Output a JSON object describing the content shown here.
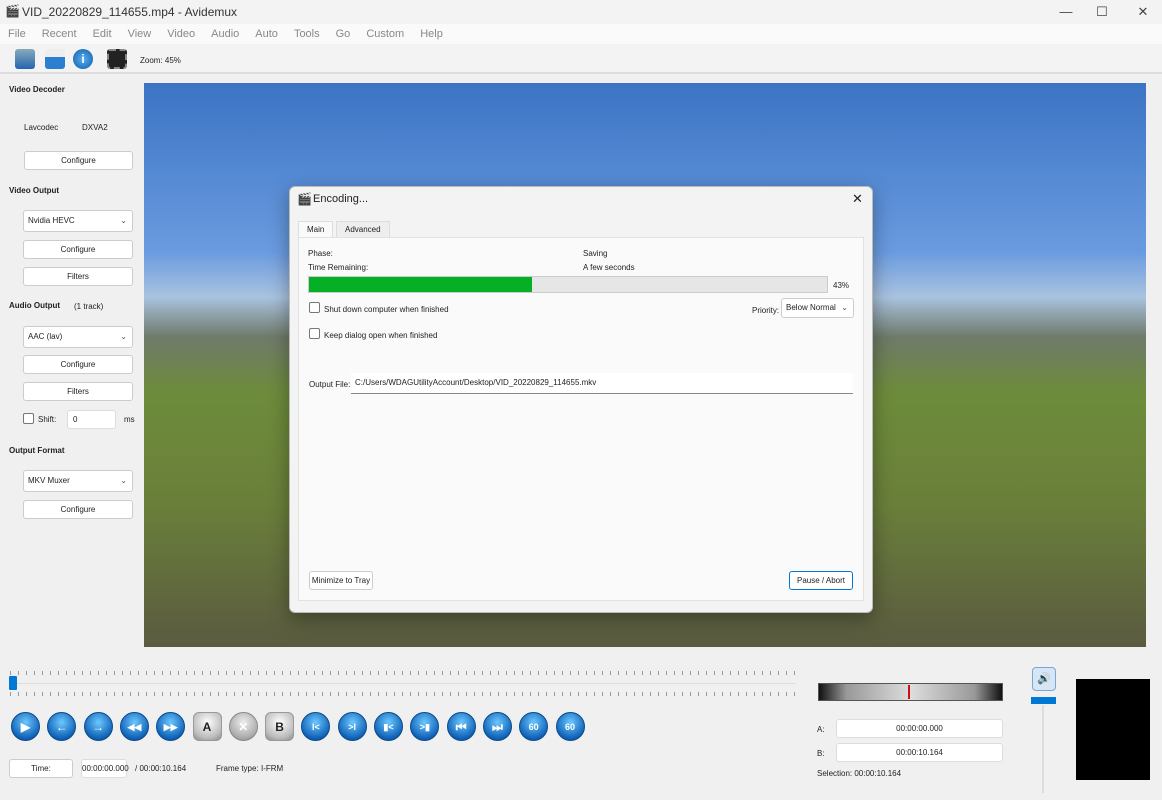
{
  "window": {
    "title": "VID_20220829_114655.mp4 - Avidemux",
    "minimize": "—",
    "maximize": "☐",
    "close": "✕"
  },
  "menu": [
    "File",
    "Recent",
    "Edit",
    "View",
    "Video",
    "Audio",
    "Auto",
    "Tools",
    "Go",
    "Custom",
    "Help"
  ],
  "toolbar": {
    "zoom": "Zoom: 45%",
    "icons": [
      "open-file-icon",
      "save-icon",
      "info-icon",
      "filters-icon"
    ]
  },
  "left": {
    "video_decoder": {
      "title": "Video Decoder",
      "decoder": "Lavcodec",
      "hw": "DXVA2",
      "configure": "Configure"
    },
    "video_output": {
      "title": "Video Output",
      "codec": "Nvidia HEVC",
      "configure": "Configure",
      "filters": "Filters"
    },
    "audio_output": {
      "title": "Audio Output",
      "tracks": "(1 track)",
      "codec": "AAC (lav)",
      "configure": "Configure",
      "filters": "Filters",
      "shift_label": "Shift:",
      "shift_value": "0",
      "shift_unit": "ms",
      "shift_checked": false
    },
    "output_format": {
      "title": "Output Format",
      "muxer": "MKV Muxer",
      "configure": "Configure"
    }
  },
  "dialog": {
    "title": "Encoding...",
    "tabs": [
      "Main",
      "Advanced"
    ],
    "active_tab": "Main",
    "phase_label": "Phase:",
    "phase_value": "Saving",
    "time_label": "Time Remaining:",
    "time_value": "A few seconds",
    "progress": 43,
    "progress_text": "43%",
    "progress_color": "#06b025",
    "shutdown_label": "Shut down computer when finished",
    "shutdown_checked": false,
    "keep_open_label": "Keep dialog open when finished",
    "keep_open_checked": false,
    "priority_label": "Priority:",
    "priority_value": "Below Normal",
    "output_label": "Output File:",
    "output_value": "C:/Users/WDAGUtilityAccount/Desktop/VID_20220829_114655.mkv",
    "minimize_button": "Minimize to Tray",
    "pause_button": "Pause / Abort"
  },
  "timeline": {
    "position": 0
  },
  "controls": [
    {
      "name": "play-button",
      "glyph": "▶"
    },
    {
      "name": "previous-frame-button",
      "glyph": "←"
    },
    {
      "name": "next-frame-button",
      "glyph": "→"
    },
    {
      "name": "rewind-button",
      "glyph": "◀◀"
    },
    {
      "name": "fast-forward-button",
      "glyph": "▶▶"
    },
    {
      "name": "set-marker-a-button",
      "glyph": "A"
    },
    {
      "name": "delete-button",
      "glyph": "✕"
    },
    {
      "name": "set-marker-b-button",
      "glyph": "B"
    },
    {
      "name": "go-marker-a-button",
      "glyph": "I<"
    },
    {
      "name": "go-marker-b-button",
      "glyph": ">I"
    },
    {
      "name": "previous-keyframe-button",
      "glyph": "▮<"
    },
    {
      "name": "next-keyframe-button",
      "glyph": ">▮"
    },
    {
      "name": "go-first-button",
      "glyph": "⏮"
    },
    {
      "name": "go-last-button",
      "glyph": "⏭"
    },
    {
      "name": "back-60-button",
      "glyph": "60"
    },
    {
      "name": "forward-60-button",
      "glyph": "60"
    }
  ],
  "status": {
    "time_button": "Time:",
    "current_time": "00:00:00.000",
    "total_time": "/ 00:00:10.164",
    "frame_type_label": "Frame type:",
    "frame_type": "I-FRM"
  },
  "selection": {
    "a_label": "A:",
    "a_value": "00:00:00.000",
    "b_label": "B:",
    "b_value": "00:00:10.164",
    "selection_text": "Selection: 00:00:10.164"
  },
  "colors": {
    "accent": "#0078d4",
    "marker": "#d01010"
  }
}
